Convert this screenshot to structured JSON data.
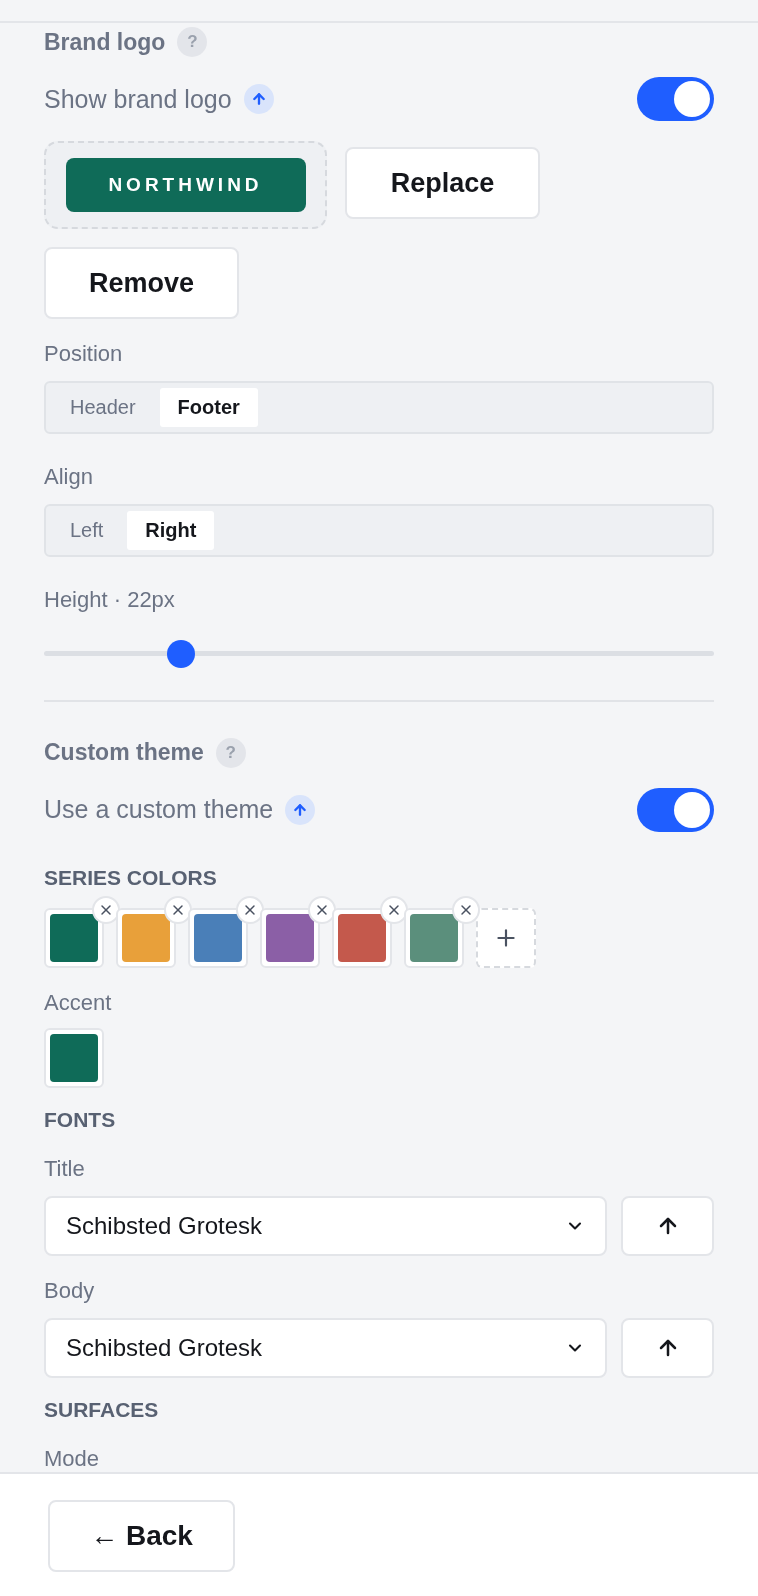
{
  "brand_logo": {
    "title": "Brand logo",
    "help": "?",
    "toggle": {
      "label": "Show brand logo",
      "on": true
    },
    "logo": {
      "text": "NORTHWIND"
    },
    "buttons": [
      "Replace",
      "Remove"
    ],
    "position": {
      "label": "Position",
      "options": [
        {
          "label": "Header",
          "selected": false
        },
        {
          "label": "Footer",
          "selected": true
        }
      ]
    },
    "align": {
      "label": "Align",
      "options": [
        {
          "label": "Left",
          "selected": false
        },
        {
          "label": "Right",
          "selected": true
        }
      ]
    },
    "height": {
      "label": "Height · 22px",
      "level": 0.204
    }
  },
  "custom_theme": {
    "title": "Custom theme",
    "help": "?",
    "toggle": {
      "label": "Use a custom theme",
      "on": true
    },
    "series_colors": {
      "heading": "SERIES COLORS",
      "swatches": [
        {
          "color": "#0f6b58"
        },
        {
          "color": "#e8a03a"
        },
        {
          "color": "#4a7fb8"
        },
        {
          "color": "#8b5fa6"
        },
        {
          "color": "#c4594c"
        },
        {
          "color": "#5b8f7c"
        }
      ]
    },
    "accent": {
      "label": "Accent",
      "color": "#0f6b58"
    },
    "fonts": {
      "heading": "FONTS",
      "fields": [
        {
          "label": "Title",
          "value": "Schibsted Grotesk"
        },
        {
          "label": "Body",
          "value": "Schibsted Grotesk"
        }
      ]
    },
    "surfaces": {
      "heading": "SURFACES",
      "mode_label": "Mode"
    }
  },
  "footer": {
    "back": "← Back"
  }
}
